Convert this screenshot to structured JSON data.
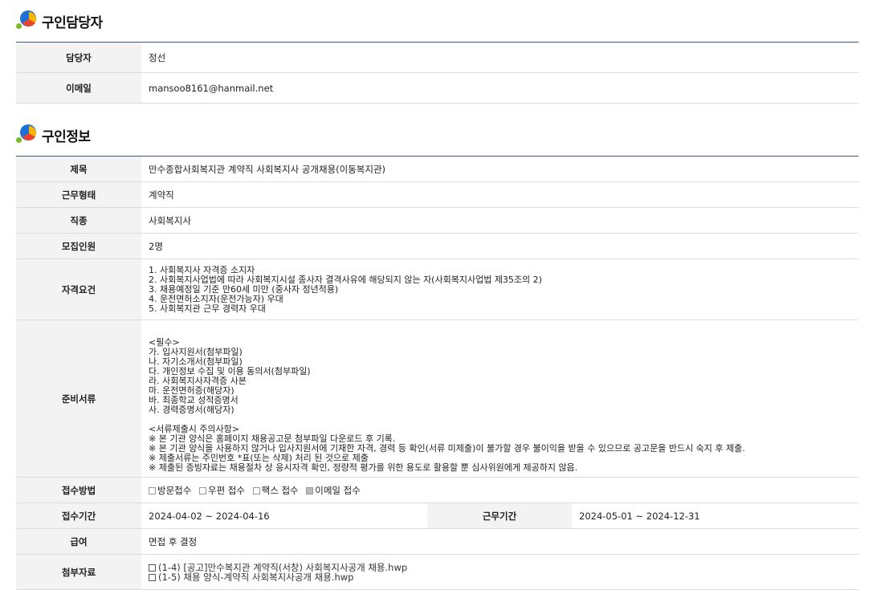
{
  "contact_section": {
    "title": "구인담당자",
    "rows": [
      {
        "label": "담당자",
        "value": "정선"
      },
      {
        "label": "이메일",
        "value": "mansoo8161@hanmail.net"
      }
    ]
  },
  "job_section": {
    "title": "구인정보",
    "title_row": {
      "label": "제목",
      "value": "만수종합사회복지관 계약직 사회복지사 공개채용(이동복지관)"
    },
    "employment_type": {
      "label": "근무형태",
      "value": "계약직"
    },
    "job_category": {
      "label": "직종",
      "value": "사회복지사"
    },
    "headcount": {
      "label": "모집인원",
      "value": "2명"
    },
    "qualifications": {
      "label": "자격요건",
      "value": "1. 사회복지사 자격증 소지자\n2. 사회복지사업법에 따라 사회복지시설 종사자 결격사유에 해당되지 않는 자(사회복지사업법 제35조의 2)\n3. 채용예정일 기준 만60세 미만 (중사자 정년적용)\n4. 운전면허소지자(운전가능자) 우대\n5. 사회복지관 근무 경력자 우대"
    },
    "documents": {
      "label": "준비서류",
      "value": "<필수>\n가. 입사지원서(첨부파일)\n나. 자기소개서(첨부파일)\n다. 개인정보 수집 및 이용 동의서(첨부파일)\n라. 사회복지사자격증 사본\n마. 운전면허증(해당자)\n바. 최종학교 성적증명서\n사. 경력증명서(해당자)\n\n<서류제출시 주의사항>\n※ 본 기관 양식은 홈페이지 채용공고문 첨부파일 다운로드 후 기록.\n※ 본 기관 양식을 사용하지 않거나 입사지원서에 기재한 자격, 경력 등 확인(서류 미제출)이 불가할 경우 불이익을 받을 수 있으므로 공고문을 반드시 숙지 후 제출.\n※ 제출서류는 주민번호 *표(또는 삭제) 처리 된 것으로 제출\n※ 제출된 증빙자료는 채용절차 상 응시자격 확인, 정량적 평가를 위한 용도로 활용할 뿐 심사위원에게 제공하지 않음."
    },
    "method": {
      "label": "접수방법",
      "options": [
        {
          "label": "방문접수",
          "checked": false
        },
        {
          "label": "우편 접수",
          "checked": false
        },
        {
          "label": "팩스 접수",
          "checked": false
        },
        {
          "label": "이메일 접수",
          "checked": true
        }
      ]
    },
    "period": {
      "label": "접수기간",
      "value": "2024-04-02 ~ 2024-04-16",
      "work_label": "근무기간",
      "work_value": "2024-05-01 ~ 2024-12-31"
    },
    "salary": {
      "label": "급여",
      "value": "면접 후 결정"
    },
    "attachments": {
      "label": "첨부자료",
      "files": [
        "(1-4) [공고]만수복지관 계약직(서창) 사회복지사공개 채용.hwp",
        "(1-5) 채용 양식-계약직 사회복지사공개 채용.hwp"
      ]
    }
  }
}
